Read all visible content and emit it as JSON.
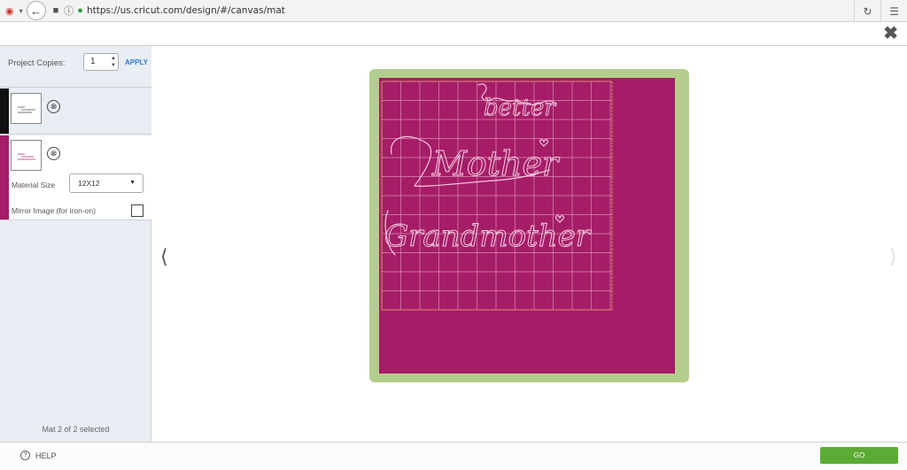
{
  "browser": {
    "url": "https://us.cricut.com/design/#/canvas/mat",
    "reload_icon": "reload-icon",
    "menu_icon": "hamburger-icon"
  },
  "app": {
    "close_icon": "close-icon"
  },
  "left_panel": {
    "project_copies_label": "Project Copies:",
    "project_copies_value": "1",
    "apply_label": "APPLY",
    "mats": [
      {
        "color": "#111111",
        "selected": false
      },
      {
        "color": "#a61d67",
        "selected": true,
        "material_size_label": "Material Size",
        "material_size_value": "12X12",
        "mirror_label": "Mirror Image (for iron-on)",
        "mirror_checked": false
      }
    ],
    "status": "Mat 2 of 2 selected"
  },
  "canvas": {
    "mat_color": "#a61d67",
    "frame_color": "#b3cd8d",
    "words": [
      "better",
      "Mother",
      "Grandmother"
    ]
  },
  "bottom": {
    "help_label": "HELP",
    "go_label": "GO",
    "go_color": "#5cab35"
  }
}
